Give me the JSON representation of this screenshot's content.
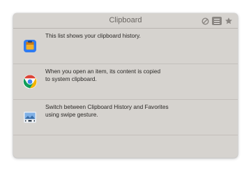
{
  "window": {
    "title": "Clipboard"
  },
  "toolbar": {
    "icons": [
      "clear-icon",
      "list-icon",
      "star-icon"
    ]
  },
  "items": [
    {
      "icon": "clipboard-app-icon",
      "lines": [
        "This list shows your clipboard history."
      ]
    },
    {
      "icon": "chrome-icon",
      "lines": [
        "When you open an item, its content is copied",
        "to system clipboard."
      ]
    },
    {
      "icon": "preview-image-icon",
      "lines": [
        "Switch between Clipboard History and Favorites",
        "using swipe gesture."
      ]
    }
  ],
  "colors": {
    "panel": "#d6d3cf",
    "title_text": "#6b6763",
    "body_text": "#2a2826"
  }
}
